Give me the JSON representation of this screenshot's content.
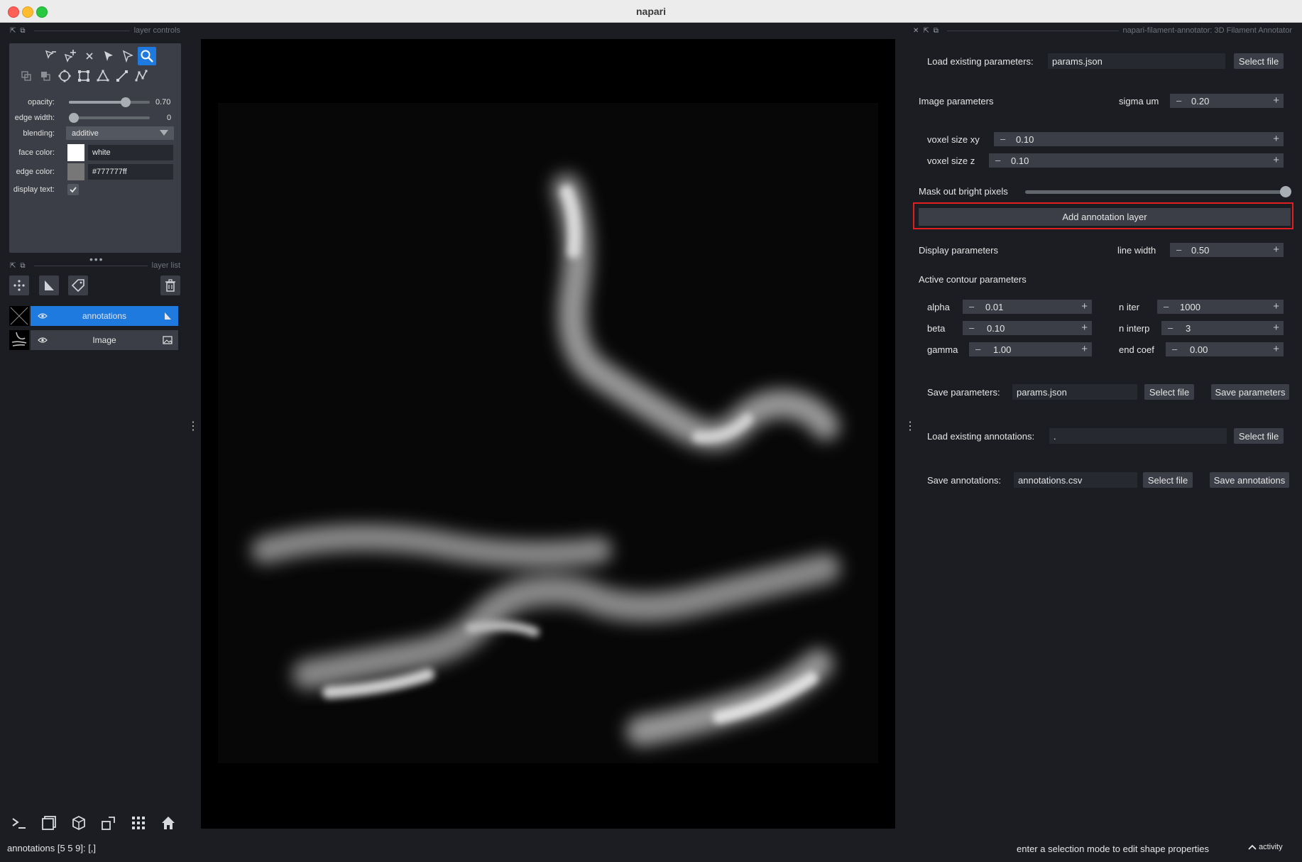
{
  "window": {
    "title": "napari"
  },
  "left_dock": {
    "controls_title": "layer controls",
    "layer_list_title": "layer list",
    "controls": {
      "opacity": {
        "label": "opacity:",
        "value": "0.70",
        "level": 0.7
      },
      "edge_width": {
        "label": "edge width:",
        "value": "0",
        "level": 0
      },
      "blending": {
        "label": "blending:",
        "value": "additive"
      },
      "face_color": {
        "label": "face color:",
        "value": "white",
        "swatch": "#ffffff"
      },
      "edge_color": {
        "label": "edge color:",
        "value": "#777777ff",
        "swatch": "#777777"
      },
      "display_text": {
        "label": "display text:",
        "checked": true
      }
    },
    "layers": [
      {
        "name": "annotations",
        "selected": true,
        "icon": "shapes-icon"
      },
      {
        "name": "Image",
        "selected": false,
        "icon": "image-icon"
      }
    ]
  },
  "plugin": {
    "title": "napari-filament-annotator: 3D Filament Annotator",
    "load_params": {
      "label": "Load existing parameters:",
      "value": "params.json",
      "button": "Select file"
    },
    "image_params": {
      "label": "Image parameters",
      "sigma_label": "sigma um",
      "sigma": "0.20",
      "voxel_xy_label": "voxel size xy",
      "voxel_xy": "0.10",
      "voxel_z_label": "voxel size z",
      "voxel_z": "0.10"
    },
    "mask": {
      "label": "Mask out bright pixels",
      "level": 1.0
    },
    "add_layer_button": "Add annotation layer",
    "display_params": {
      "label": "Display parameters",
      "line_width_label": "line width",
      "line_width": "0.50"
    },
    "active_contour": {
      "label": "Active contour parameters",
      "alpha_label": "alpha",
      "alpha": "0.01",
      "beta_label": "beta",
      "beta": "0.10",
      "gamma_label": "gamma",
      "gamma": "1.00",
      "n_iter_label": "n iter",
      "n_iter": "1000",
      "n_interp_label": "n interp",
      "n_interp": "3",
      "end_coef_label": "end coef",
      "end_coef": "0.00"
    },
    "save_params": {
      "label": "Save parameters:",
      "value": "params.json",
      "select": "Select file",
      "save": "Save parameters"
    },
    "load_annotations": {
      "label": "Load existing annotations:",
      "value": ".",
      "button": "Select file"
    },
    "save_annotations": {
      "label": "Save annotations:",
      "value": "annotations.csv",
      "select": "Select file",
      "save": "Save annotations"
    }
  },
  "status": {
    "left": "annotations [5 5 9]: [,]",
    "right": "enter a selection mode to edit shape properties",
    "activity": "activity"
  }
}
